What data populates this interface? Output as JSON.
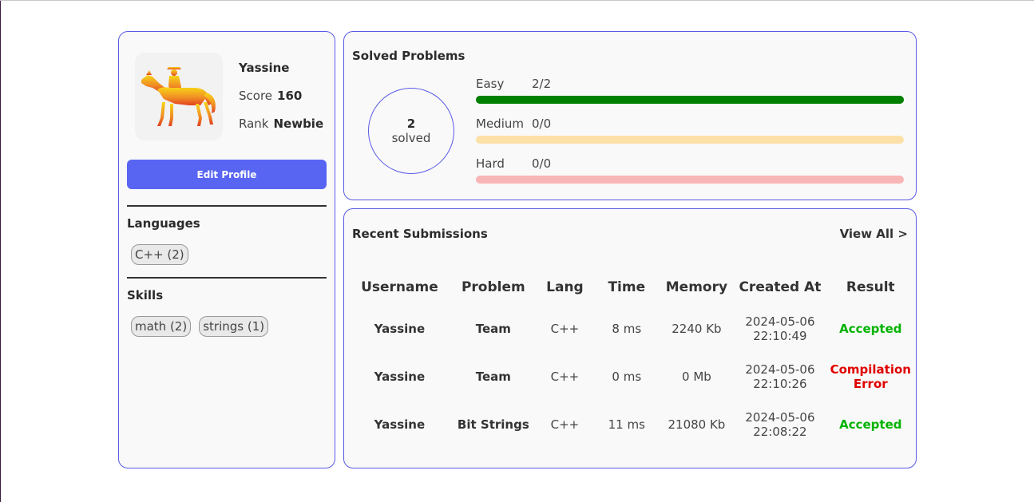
{
  "profile": {
    "username": "Yassine",
    "score_label": "Score",
    "score": "160",
    "rank_label": "Rank",
    "rank": "Newbie",
    "avatar_icon": "horse-rider-icon",
    "edit_button": "Edit Profile",
    "languages_title": "Languages",
    "languages": [
      "C++ (2)"
    ],
    "skills_title": "Skills",
    "skills": [
      "math (2)",
      "strings (1)"
    ]
  },
  "solved": {
    "title": "Solved Problems",
    "count": "2",
    "count_label": "solved",
    "difficulties": [
      {
        "label": "Easy",
        "value": "2/2",
        "fraction": 1.0,
        "color": "#008000",
        "track": "#008000"
      },
      {
        "label": "Medium",
        "value": "0/0",
        "fraction": 0.0,
        "color": "#ffa500",
        "track": "#fde0a8"
      },
      {
        "label": "Hard",
        "value": "0/0",
        "fraction": 0.0,
        "color": "#ff0000",
        "track": "#f9b6b6"
      }
    ]
  },
  "submissions": {
    "title": "Recent Submissions",
    "view_all": "View All >",
    "columns": [
      "Username",
      "Problem",
      "Lang",
      "Time",
      "Memory",
      "Created At",
      "Result"
    ],
    "rows": [
      {
        "username": "Yassine",
        "problem": "Team",
        "lang": "C++",
        "time": "8 ms",
        "memory": "2240 Kb",
        "date": "2024-05-06",
        "clock": "22:10:49",
        "result": "Accepted",
        "result_color": "#00b300"
      },
      {
        "username": "Yassine",
        "problem": "Team",
        "lang": "C++",
        "time": "0 ms",
        "memory": "0 Mb",
        "date": "2024-05-06",
        "clock": "22:10:26",
        "result": "Compilation Error",
        "result_color": "#e00000"
      },
      {
        "username": "Yassine",
        "problem": "Bit Strings",
        "lang": "C++",
        "time": "11 ms",
        "memory": "21080 Kb",
        "date": "2024-05-06",
        "clock": "22:08:22",
        "result": "Accepted",
        "result_color": "#00b300"
      }
    ]
  }
}
